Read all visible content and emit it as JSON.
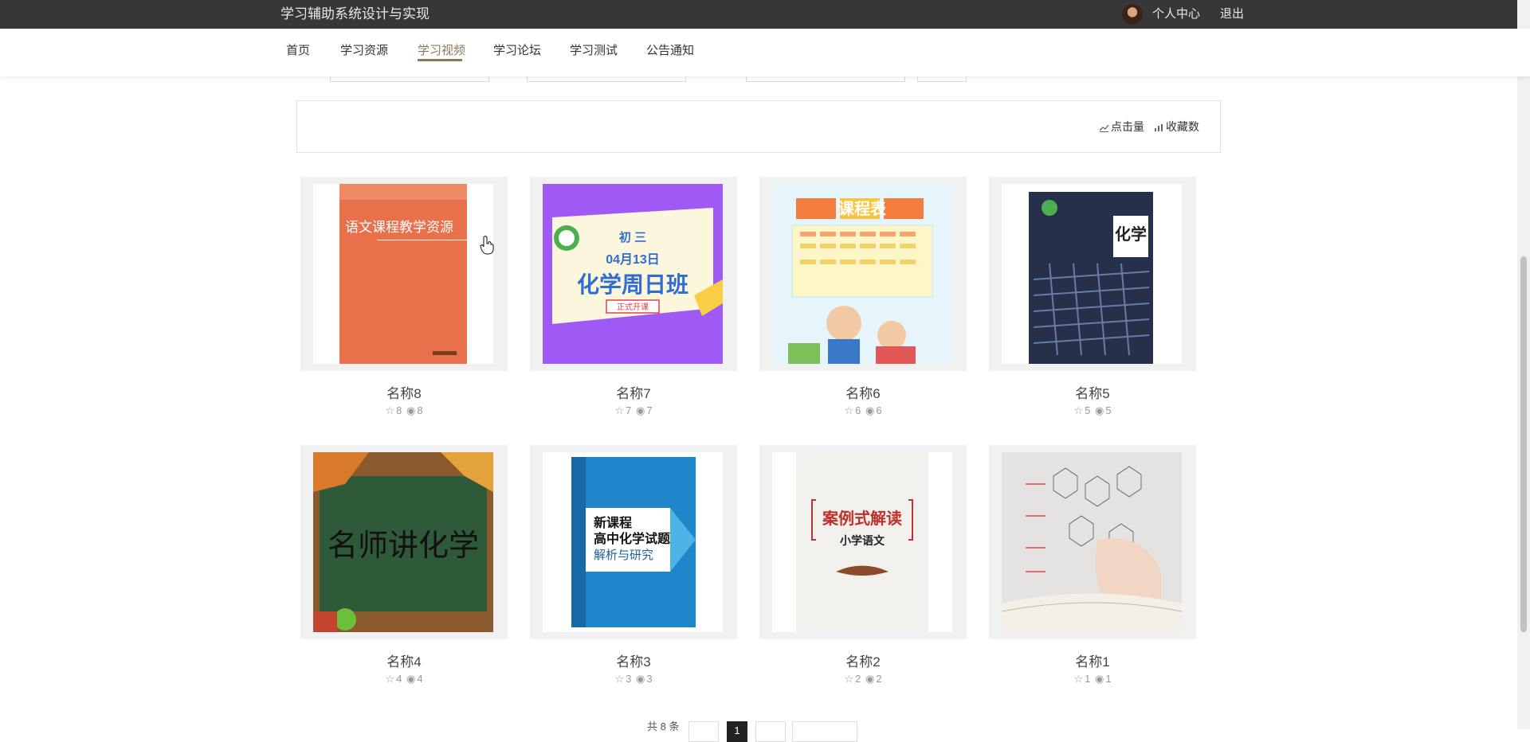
{
  "header": {
    "site_title": "学习辅助系统设计与实现",
    "personal_center": "个人中心",
    "logout": "退出"
  },
  "nav": {
    "items": [
      "首页",
      "学习资源",
      "学习视频",
      "学习论坛",
      "学习测试",
      "公告通知"
    ],
    "active": "学习视频"
  },
  "sort": {
    "clicks_label": "点击量",
    "favorites_label": "收藏数"
  },
  "cards": [
    {
      "name": "名称8",
      "stars": "8",
      "views": "8",
      "image": "语文课程教学资源 book cover"
    },
    {
      "name": "名称7",
      "stars": "7",
      "views": "7",
      "image": "初三 04月13日 化学周日班 poster"
    },
    {
      "name": "名称6",
      "stars": "6",
      "views": "6",
      "image": "课程表 cartoon schedule"
    },
    {
      "name": "名称5",
      "stars": "5",
      "views": "5",
      "image": "化学 textbook cover"
    },
    {
      "name": "名称4",
      "stars": "4",
      "views": "4",
      "image": "名师讲化学 chalkboard"
    },
    {
      "name": "名称3",
      "stars": "3",
      "views": "3",
      "image": "新课程高中化学试题解析与研究 book"
    },
    {
      "name": "名称2",
      "stars": "2",
      "views": "2",
      "image": "案例式解读 小学语文 book"
    },
    {
      "name": "名称1",
      "stars": "1",
      "views": "1",
      "image": "hand with molecular formulas over book"
    }
  ],
  "thumb_text": {
    "c8_title": "语文课程教学资源",
    "c7_grade": "初 三",
    "c7_date": "04月13日",
    "c7_title": "化学周日班",
    "c7_badge": "正式开课",
    "c6_title": "课程表",
    "c5_title": "化学",
    "c4_title": "名师讲化学",
    "c3_line1": "新课程",
    "c3_line2": "高中化学试题",
    "c3_line3": "解析与研究",
    "c2_line1": "案例式解读",
    "c2_line2": "小学语文"
  },
  "pagination": {
    "total": "共 8 条",
    "current": "1"
  },
  "colors": {
    "topbar": "#373737",
    "accent": "#8a7a58"
  }
}
